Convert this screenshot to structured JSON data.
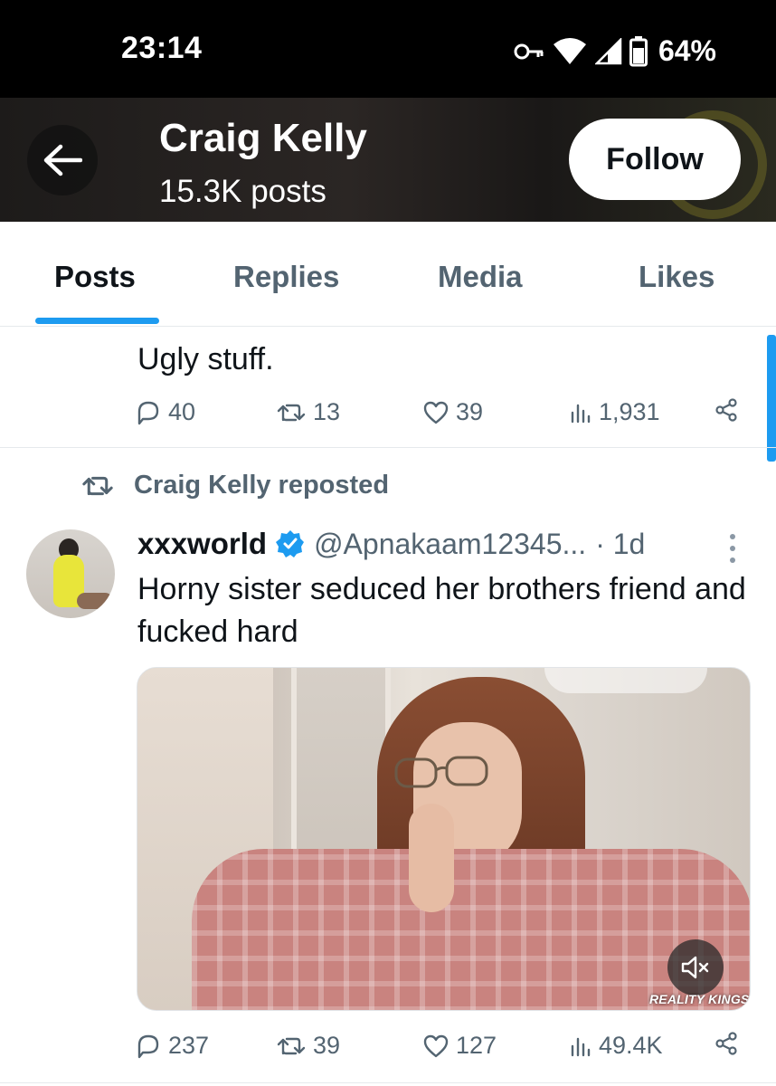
{
  "status_bar": {
    "time": "23:14",
    "battery": "64%",
    "icons": [
      "key-icon",
      "wifi-icon",
      "signal-icon",
      "battery-icon"
    ]
  },
  "header": {
    "name": "Craig Kelly",
    "posts_count": "15.3K posts",
    "follow_label": "Follow"
  },
  "tabs": [
    {
      "label": "Posts",
      "active": true
    },
    {
      "label": "Replies",
      "active": false
    },
    {
      "label": "Media",
      "active": false
    },
    {
      "label": "Likes",
      "active": false
    }
  ],
  "previous_post": {
    "text": "Ugly stuff.",
    "replies": "40",
    "reposts": "13",
    "likes": "39",
    "views": "1,931"
  },
  "post": {
    "repost_label": "Craig Kelly reposted",
    "author_name": "xxxworld",
    "handle": "@Apnakaam12345...",
    "time": "· 1d",
    "text": "Horny sister seduced her brothers friend and fucked hard",
    "media": {
      "watermark": "REALITY KINGS",
      "muted": true
    },
    "replies": "237",
    "reposts": "39",
    "likes": "127",
    "views": "49.4K"
  },
  "colors": {
    "accent": "#1d9bf0",
    "secondary_text": "#536471",
    "primary_text": "#0f1419"
  }
}
